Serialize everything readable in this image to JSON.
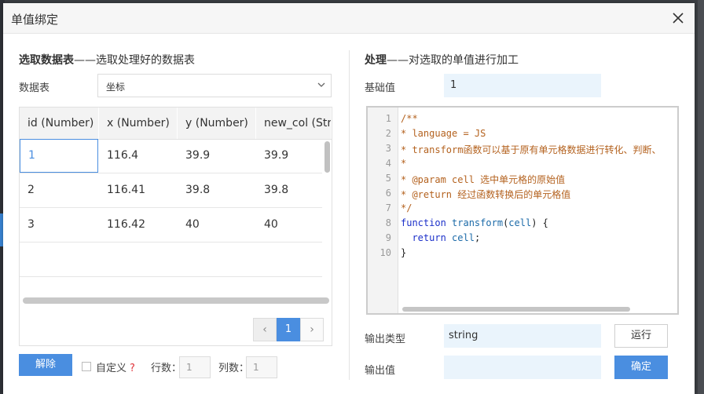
{
  "dialog": {
    "title": "单值绑定"
  },
  "left": {
    "section_title_bold": "选取数据表",
    "section_title_rest": "——选取处理好的数据表",
    "table_label": "数据表",
    "table_select_value": "坐标",
    "columns": [
      "id (Number)",
      "x (Number)",
      "y (Number)",
      "new_col (String)"
    ],
    "rows": [
      [
        "1",
        "116.4",
        "39.9",
        "39.9"
      ],
      [
        "2",
        "116.41",
        "39.8",
        "39.8"
      ],
      [
        "3",
        "116.42",
        "40",
        "40"
      ]
    ],
    "pagination": {
      "prev": "‹",
      "current": "1",
      "next": "›"
    },
    "unbind_button": "解除",
    "custom_label": "自定义",
    "help_mark": "?",
    "rows_label": "行数：",
    "rows_value": "1",
    "cols_label": "列数：",
    "cols_value": "1"
  },
  "right": {
    "section_title_bold": "处理",
    "section_title_rest": "——对选取的单值进行加工",
    "base_value_label": "基础值",
    "base_value": "1",
    "code_lines": [
      {
        "n": "1",
        "text": "/**",
        "kind": "comment"
      },
      {
        "n": "2",
        "text": "* language = JS",
        "kind": "comment"
      },
      {
        "n": "3",
        "text": "* transform函数可以基于原有单元格数据进行转化、判断、",
        "kind": "comment"
      },
      {
        "n": "4",
        "text": "*",
        "kind": "comment"
      },
      {
        "n": "5",
        "text": "* @param cell 选中单元格的原始值",
        "kind": "comment"
      },
      {
        "n": "6",
        "text": "* @return 经过函数转换后的单元格值",
        "kind": "comment"
      },
      {
        "n": "7",
        "text": "*/",
        "kind": "comment"
      },
      {
        "n": "8",
        "text": "",
        "kind": "fn-decl"
      },
      {
        "n": "9",
        "text": "",
        "kind": "return"
      },
      {
        "n": "10",
        "text": "}",
        "kind": "plain"
      }
    ],
    "code_tokens": {
      "function_kw": "function",
      "function_name": "transform",
      "param_open": "(",
      "param": "cell",
      "param_close": ") {",
      "return_kw": "return",
      "return_val": "cell",
      "return_end": ";"
    },
    "output_type_label": "输出类型",
    "output_type_value": "string",
    "run_button": "运行",
    "output_value_label": "输出值",
    "output_value": "",
    "confirm_button": "确定"
  },
  "colors": {
    "accent": "#4a8ee0",
    "comment": "#b4621f",
    "keyword": "#1b2fc9",
    "light_field": "#eaf4fc"
  }
}
